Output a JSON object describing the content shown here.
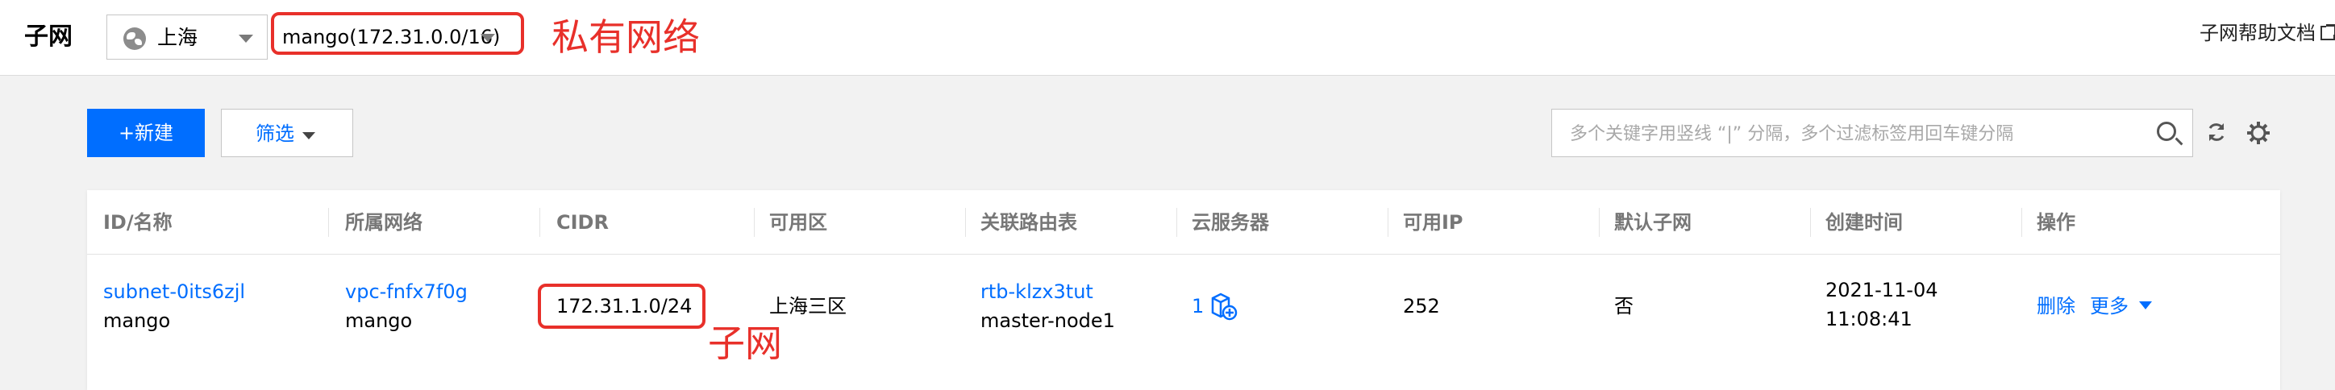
{
  "header": {
    "title": "子网",
    "region": "上海",
    "vpc": "mango(172.31.0.0/16)",
    "help_link": "子网帮助文档"
  },
  "annotations": {
    "vpc_note": "私有网络",
    "cidr_note": "子网",
    "color": "#e8302a"
  },
  "toolbar": {
    "new_label": "+新建",
    "filter_label": "筛选",
    "search_placeholder": "多个关键字用竖线 “|” 分隔，多个过滤标签用回车键分隔"
  },
  "table": {
    "columns": [
      "ID/名称",
      "所属网络",
      "CIDR",
      "可用区",
      "关联路由表",
      "云服务器",
      "可用IP",
      "默认子网",
      "创建时间",
      "操作"
    ],
    "rows": [
      {
        "id": "subnet-0its6zjl",
        "name": "mango",
        "vpc_id": "vpc-fnfx7f0g",
        "vpc_name": "mango",
        "cidr": "172.31.1.0/24",
        "zone": "上海三区",
        "route_table_id": "rtb-klzx3tut",
        "route_table_name": "master-node1",
        "cvm_count": "1",
        "available_ip": "252",
        "default_subnet": "否",
        "created_date": "2021-11-04",
        "created_time": "11:08:41",
        "action_delete": "删除",
        "action_more": "更多"
      }
    ]
  },
  "colors": {
    "accent": "#006eff",
    "annotation": "#e8302a",
    "page_bg": "#f2f2f2"
  },
  "icons": [
    "globe-icon",
    "chevron-down-icon",
    "external-link-icon",
    "search-icon",
    "refresh-icon",
    "gear-icon",
    "cvm-add-icon"
  ]
}
